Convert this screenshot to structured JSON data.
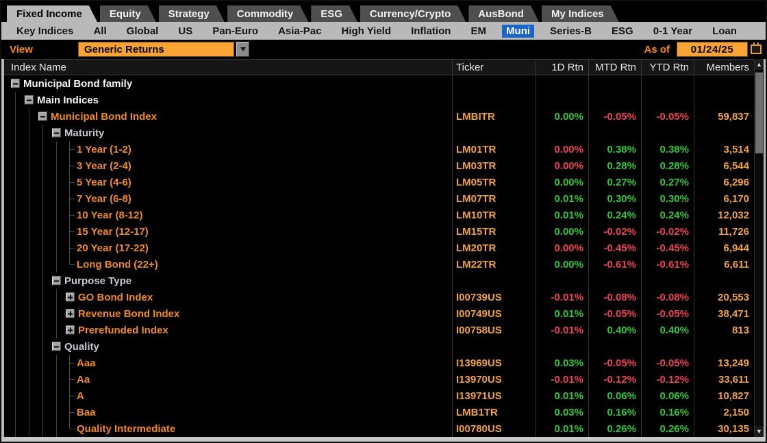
{
  "tabs": {
    "items": [
      {
        "label": "Fixed Income",
        "active": true
      },
      {
        "label": "Equity",
        "active": false
      },
      {
        "label": "Strategy",
        "active": false
      },
      {
        "label": "Commodity",
        "active": false
      },
      {
        "label": "ESG",
        "active": false
      },
      {
        "label": "Currency/Crypto",
        "active": false
      },
      {
        "label": "AusBond",
        "active": false
      },
      {
        "label": "My Indices",
        "active": false
      }
    ]
  },
  "subnav": {
    "items": [
      {
        "label": "Key Indices",
        "selected": false
      },
      {
        "label": "All",
        "selected": false
      },
      {
        "label": "Global",
        "selected": false
      },
      {
        "label": "US",
        "selected": false
      },
      {
        "label": "Pan-Euro",
        "selected": false
      },
      {
        "label": "Asia-Pac",
        "selected": false
      },
      {
        "label": "High Yield",
        "selected": false
      },
      {
        "label": "Inflation",
        "selected": false
      },
      {
        "label": "EM",
        "selected": false
      },
      {
        "label": "Muni",
        "selected": true
      },
      {
        "label": "Series-B",
        "selected": false
      },
      {
        "label": "ESG",
        "selected": false
      },
      {
        "label": "0-1 Year",
        "selected": false
      },
      {
        "label": "Loan",
        "selected": false
      }
    ]
  },
  "toolbar": {
    "view_label": "View",
    "view_value": "Generic Returns",
    "as_of_label": "As of",
    "as_of_date": "01/24/25"
  },
  "table": {
    "columns": [
      "Index Name",
      "Ticker",
      "1D Rtn",
      "MTD Rtn",
      "YTD Rtn",
      "Members"
    ],
    "rows": [
      {
        "name": "Municipal Bond family",
        "level": 0,
        "expander": "minus",
        "name_style": "white",
        "ticker": "",
        "rtn_1d": null,
        "rtn_mtd": null,
        "rtn_ytd": null,
        "members": ""
      },
      {
        "name": "Main Indices",
        "level": 1,
        "expander": "minus",
        "name_style": "white",
        "ticker": "",
        "rtn_1d": null,
        "rtn_mtd": null,
        "rtn_ytd": null,
        "members": ""
      },
      {
        "name": "Municipal Bond Index",
        "level": 2,
        "expander": "minus",
        "name_style": "orange",
        "ticker": "LMBITR",
        "rtn_1d": {
          "v": "0.00%",
          "c": "up"
        },
        "rtn_mtd": {
          "v": "-0.05%",
          "c": "down"
        },
        "rtn_ytd": {
          "v": "-0.05%",
          "c": "down"
        },
        "members": "59,837"
      },
      {
        "name": "Maturity",
        "level": 3,
        "expander": "minus",
        "name_style": "section",
        "ticker": "",
        "rtn_1d": null,
        "rtn_mtd": null,
        "rtn_ytd": null,
        "members": ""
      },
      {
        "name": "1 Year (1-2)",
        "level": 4,
        "expander": "branch",
        "name_style": "orange",
        "ticker": "LM01TR",
        "rtn_1d": {
          "v": "0.00%",
          "c": "down"
        },
        "rtn_mtd": {
          "v": "0.38%",
          "c": "up"
        },
        "rtn_ytd": {
          "v": "0.38%",
          "c": "up"
        },
        "members": "3,514"
      },
      {
        "name": "3 Year (2-4)",
        "level": 4,
        "expander": "branch",
        "name_style": "orange",
        "ticker": "LM03TR",
        "rtn_1d": {
          "v": "0.00%",
          "c": "down"
        },
        "rtn_mtd": {
          "v": "0.28%",
          "c": "up"
        },
        "rtn_ytd": {
          "v": "0.28%",
          "c": "up"
        },
        "members": "6,544"
      },
      {
        "name": "5 Year (4-6)",
        "level": 4,
        "expander": "branch",
        "name_style": "orange",
        "ticker": "LM05TR",
        "rtn_1d": {
          "v": "0.00%",
          "c": "up"
        },
        "rtn_mtd": {
          "v": "0.27%",
          "c": "up"
        },
        "rtn_ytd": {
          "v": "0.27%",
          "c": "up"
        },
        "members": "6,296"
      },
      {
        "name": "7 Year (6-8)",
        "level": 4,
        "expander": "branch",
        "name_style": "orange",
        "ticker": "LM07TR",
        "rtn_1d": {
          "v": "0.01%",
          "c": "up"
        },
        "rtn_mtd": {
          "v": "0.30%",
          "c": "up"
        },
        "rtn_ytd": {
          "v": "0.30%",
          "c": "up"
        },
        "members": "6,170"
      },
      {
        "name": "10 Year (8-12)",
        "level": 4,
        "expander": "branch",
        "name_style": "orange",
        "ticker": "LM10TR",
        "rtn_1d": {
          "v": "0.01%",
          "c": "up"
        },
        "rtn_mtd": {
          "v": "0.24%",
          "c": "up"
        },
        "rtn_ytd": {
          "v": "0.24%",
          "c": "up"
        },
        "members": "12,032"
      },
      {
        "name": "15 Year (12-17)",
        "level": 4,
        "expander": "branch",
        "name_style": "orange",
        "ticker": "LM15TR",
        "rtn_1d": {
          "v": "0.00%",
          "c": "up"
        },
        "rtn_mtd": {
          "v": "-0.02%",
          "c": "down"
        },
        "rtn_ytd": {
          "v": "-0.02%",
          "c": "down"
        },
        "members": "11,726"
      },
      {
        "name": "20 Year (17-22)",
        "level": 4,
        "expander": "branch",
        "name_style": "orange",
        "ticker": "LM20TR",
        "rtn_1d": {
          "v": "0.00%",
          "c": "down"
        },
        "rtn_mtd": {
          "v": "-0.45%",
          "c": "down"
        },
        "rtn_ytd": {
          "v": "-0.45%",
          "c": "down"
        },
        "members": "6,944"
      },
      {
        "name": "Long Bond (22+)",
        "level": 4,
        "expander": "branch_end",
        "name_style": "orange",
        "ticker": "LM22TR",
        "rtn_1d": {
          "v": "0.00%",
          "c": "up"
        },
        "rtn_mtd": {
          "v": "-0.61%",
          "c": "down"
        },
        "rtn_ytd": {
          "v": "-0.61%",
          "c": "down"
        },
        "members": "6,611"
      },
      {
        "name": "Purpose Type",
        "level": 3,
        "expander": "minus",
        "name_style": "section",
        "ticker": "",
        "rtn_1d": null,
        "rtn_mtd": null,
        "rtn_ytd": null,
        "members": ""
      },
      {
        "name": "GO Bond Index",
        "level": 4,
        "expander": "plus",
        "name_style": "orange",
        "ticker": "I00739US",
        "rtn_1d": {
          "v": "-0.01%",
          "c": "down"
        },
        "rtn_mtd": {
          "v": "-0.08%",
          "c": "down"
        },
        "rtn_ytd": {
          "v": "-0.08%",
          "c": "down"
        },
        "members": "20,553"
      },
      {
        "name": "Revenue Bond Index",
        "level": 4,
        "expander": "plus",
        "name_style": "orange",
        "ticker": "I00749US",
        "rtn_1d": {
          "v": "0.01%",
          "c": "up"
        },
        "rtn_mtd": {
          "v": "-0.05%",
          "c": "down"
        },
        "rtn_ytd": {
          "v": "-0.05%",
          "c": "down"
        },
        "members": "38,471"
      },
      {
        "name": "Prerefunded Index",
        "level": 4,
        "expander": "plus",
        "name_style": "orange",
        "ticker": "I00758US",
        "rtn_1d": {
          "v": "-0.01%",
          "c": "down"
        },
        "rtn_mtd": {
          "v": "0.40%",
          "c": "up"
        },
        "rtn_ytd": {
          "v": "0.40%",
          "c": "up"
        },
        "members": "813"
      },
      {
        "name": "Quality",
        "level": 3,
        "expander": "minus",
        "name_style": "section",
        "ticker": "",
        "rtn_1d": null,
        "rtn_mtd": null,
        "rtn_ytd": null,
        "members": ""
      },
      {
        "name": "Aaa",
        "level": 4,
        "expander": "branch",
        "name_style": "orange",
        "ticker": "I13969US",
        "rtn_1d": {
          "v": "0.03%",
          "c": "up"
        },
        "rtn_mtd": {
          "v": "-0.05%",
          "c": "down"
        },
        "rtn_ytd": {
          "v": "-0.05%",
          "c": "down"
        },
        "members": "13,249"
      },
      {
        "name": "Aa",
        "level": 4,
        "expander": "branch",
        "name_style": "orange",
        "ticker": "I13970US",
        "rtn_1d": {
          "v": "-0.01%",
          "c": "down"
        },
        "rtn_mtd": {
          "v": "-0.12%",
          "c": "down"
        },
        "rtn_ytd": {
          "v": "-0.12%",
          "c": "down"
        },
        "members": "33,611"
      },
      {
        "name": "A",
        "level": 4,
        "expander": "branch",
        "name_style": "orange",
        "ticker": "I13971US",
        "rtn_1d": {
          "v": "0.01%",
          "c": "up"
        },
        "rtn_mtd": {
          "v": "0.06%",
          "c": "up"
        },
        "rtn_ytd": {
          "v": "0.06%",
          "c": "up"
        },
        "members": "10,827"
      },
      {
        "name": "Baa",
        "level": 4,
        "expander": "branch",
        "name_style": "orange",
        "ticker": "LMB1TR",
        "rtn_1d": {
          "v": "0.03%",
          "c": "up"
        },
        "rtn_mtd": {
          "v": "0.16%",
          "c": "up"
        },
        "rtn_ytd": {
          "v": "0.16%",
          "c": "up"
        },
        "members": "2,150"
      },
      {
        "name": "Quality Intermediate",
        "level": 4,
        "expander": "branch_end",
        "name_style": "orange",
        "ticker": "I00780US",
        "rtn_1d": {
          "v": "0.01%",
          "c": "up"
        },
        "rtn_mtd": {
          "v": "0.26%",
          "c": "up"
        },
        "rtn_ytd": {
          "v": "0.26%",
          "c": "up"
        },
        "members": "30,135"
      }
    ]
  },
  "scrollbar": {
    "up_icon": "▲",
    "down_icon": "▼"
  },
  "colors": {
    "positive": "#2cc937",
    "negative": "#f24053",
    "amber": "#f2a33c",
    "orange_name": "#f28b1d",
    "selected_blue": "#1766c8",
    "control_amber": "#f8a333",
    "label_orange": "#ff8b00"
  }
}
